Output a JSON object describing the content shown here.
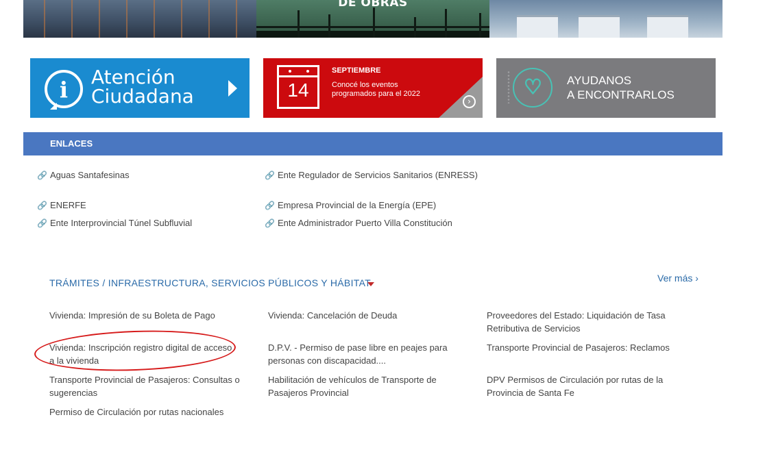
{
  "hero": {
    "captions": [
      "",
      "DE OBRAS",
      ""
    ]
  },
  "banners": {
    "atencion": {
      "line1": "Atención",
      "line2": "Ciudadana"
    },
    "septiembre": {
      "day": "14",
      "month": "SEPTIEMBRE",
      "desc": "Conocé los eventos programados para el 2022"
    },
    "ayudanos": {
      "line1": "AYUDANOS",
      "line2": "A ENCONTRARLOS"
    }
  },
  "enlaces": {
    "title": "ENLACES",
    "left": [
      "Aguas Santafesinas",
      "ENERFE",
      "Ente Interprovincial Túnel Subfluvial"
    ],
    "right": [
      "Ente Regulador de Servicios Sanitarios (ENRESS)",
      "Empresa Provincial de la Energía (EPE)",
      "Ente Administrador Puerto Villa Constitución"
    ]
  },
  "tramites": {
    "title": "TRÁMITES / INFRAESTRUCTURA, SERVICIOS PÚBLICOS Y HÁBITAT",
    "ver_mas": "Ver más ›",
    "items": [
      "Vivienda: Impresión de su Boleta de Pago",
      "Vivienda: Cancelación de Deuda",
      "Proveedores del Estado: Liquidación de Tasa Retributiva de Servicios",
      "Vivienda: Inscripción registro digital de acceso a la vivienda",
      "D.P.V. - Permiso de pase libre en peajes para personas con discapacidad....",
      "Transporte Provincial de Pasajeros: Reclamos",
      "Transporte Provincial de Pasajeros: Consultas o sugerencias",
      "Habilitación de vehículos de Transporte de Pasajeros Provincial",
      "DPV Permisos de Circulación por rutas de la Provincia de Santa Fe",
      "Permiso de Circulación por rutas nacionales"
    ]
  },
  "colors": {
    "atencion_bg": "#1a8bd0",
    "septiembre_bg": "#cc0a0e",
    "ayudanos_bg": "#7b7b7e",
    "enlaces_bar": "#4a77c1",
    "link_blue": "#2a6aa8",
    "annotation_red": "#d61a1a"
  },
  "icons": [
    "info-bubble-icon",
    "arrow-right-icon",
    "calendar-icon",
    "chevron-right-circle-icon",
    "heart-icon",
    "link-chain-icon",
    "caret-down-icon"
  ]
}
